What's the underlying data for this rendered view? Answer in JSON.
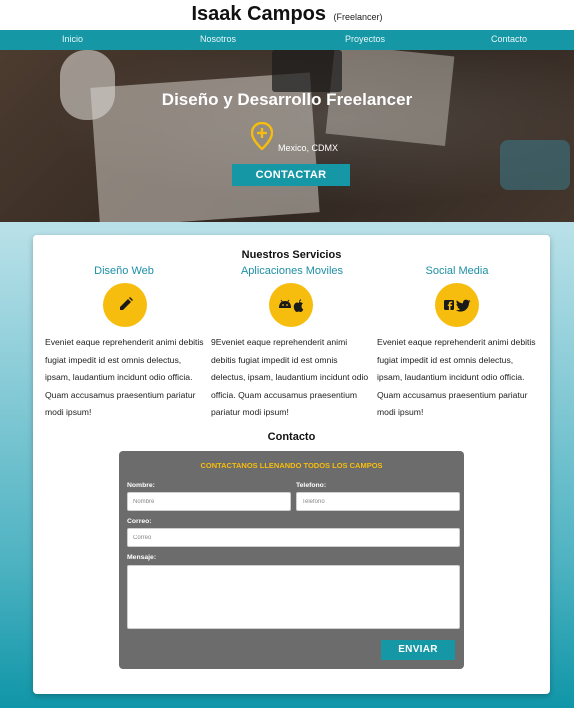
{
  "header": {
    "name": "Isaak Campos",
    "subtitle": "(Freelancer)"
  },
  "nav": {
    "items": [
      {
        "label": "Inicio"
      },
      {
        "label": "Nosotros"
      },
      {
        "label": "Proyectos"
      },
      {
        "label": "Contacto"
      }
    ]
  },
  "hero": {
    "title": "Diseño y Desarrollo Freelancer",
    "location": "Mexico, CDMX",
    "cta_label": "CONTACTAR",
    "pin_icon": "location-pin-plus-icon",
    "pin_color": "#f7bd0e"
  },
  "services": {
    "heading": "Nuestros Servicios",
    "items": [
      {
        "title": "Diseño Web",
        "icon": "pencil-icon",
        "text": "Eveniet eaque reprehenderit animi debitis fugiat impedit id est omnis delectus, ipsam, laudantium incidunt odio officia. Quam accusamus praesentium pariatur modi ipsum!"
      },
      {
        "title": "Aplicaciones Moviles",
        "icon": "android-apple-icon",
        "text": "9Eveniet eaque reprehenderit animi debitis fugiat impedit id est omnis delectus, ipsam, laudantium incidunt odio officia. Quam accusamus praesentium pariatur modi ipsum!"
      },
      {
        "title": "Social Media",
        "icon": "facebook-twitter-icon",
        "text": "Eveniet eaque reprehenderit animi debitis fugiat impedit id est omnis delectus, ipsam, laudantium incidunt odio officia. Quam accusamus praesentium pariatur modi ipsum!"
      }
    ]
  },
  "contact": {
    "heading": "Contacto",
    "form_heading": "CONTACTANOS LLENANDO TODOS LOS CAMPOS",
    "nombre_label": "Nombre:",
    "nombre_placeholder": "Nombre",
    "telefono_label": "Telefono:",
    "telefono_placeholder": "Telefono",
    "correo_label": "Correo:",
    "correo_placeholder": "Correo",
    "mensaje_label": "Mensaje:",
    "submit_label": "ENVIAR"
  },
  "colors": {
    "accent": "#1597a5",
    "highlight": "#f7bd0e",
    "service_title": "#1e8fa6",
    "form_bg": "#6c6c6c"
  }
}
